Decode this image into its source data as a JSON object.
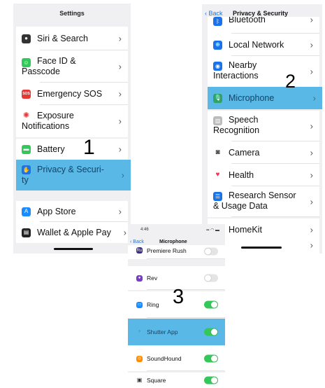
{
  "step_numbers": [
    "1",
    "2",
    "3"
  ],
  "settings": {
    "title": "Settings",
    "items": [
      {
        "label": "Siri & Search",
        "icon": "siri-icon",
        "color": "#333333"
      },
      {
        "label": "Face ID &",
        "label2": "Passcode",
        "icon": "face-id-icon",
        "color": "#34c759"
      },
      {
        "label": "Emergency SOS",
        "icon": "sos-icon",
        "color": "#e53935",
        "badge": "SOS"
      },
      {
        "label": "Exposure",
        "label2": "Notifications",
        "icon": "exposure-icon",
        "color": "#e53935"
      },
      {
        "label": "Battery",
        "icon": "battery-icon",
        "color": "#34c759"
      },
      {
        "label": "Privacy & Securi-",
        "label2": "ty",
        "icon": "hand-icon",
        "color": "#1a73e8"
      },
      {
        "label": "App Store",
        "icon": "app-store-icon",
        "color": "#1a8cff"
      },
      {
        "label": "Wallet & Apple Pay",
        "icon": "wallet-icon",
        "color": "#222222"
      }
    ]
  },
  "privacy": {
    "back": "Back",
    "title": "Privacy & Security",
    "items": [
      {
        "label": "Bluetooth",
        "icon": "bluetooth-icon",
        "color": "#1a73e8"
      },
      {
        "label": "Local Network",
        "icon": "network-icon",
        "color": "#1a73e8"
      },
      {
        "label": "Nearby",
        "label2": "Interactions",
        "icon": "nearby-icon",
        "color": "#1a73e8"
      },
      {
        "label": "Microphone",
        "icon": "microphone-icon",
        "color": "#34c759"
      },
      {
        "label": "Speech",
        "label2": "Recognition",
        "icon": "speech-icon",
        "color": "#999999"
      },
      {
        "label": "Camera",
        "icon": "camera-icon",
        "color": "#555555"
      },
      {
        "label": "Health",
        "icon": "health-icon",
        "color": "#ff2d55"
      },
      {
        "label": "Research Sensor",
        "label2": "& Usage Data",
        "icon": "research-icon",
        "color": "#1a73e8"
      },
      {
        "label": "HomeKit",
        "icon": "homekit-icon",
        "color": "#ff9500"
      }
    ]
  },
  "microphone": {
    "status_time": "4:46",
    "back": "Back",
    "title": "Microphone",
    "apps": [
      {
        "label": "Premiere Rush",
        "icon": "premiere-rush-icon",
        "color": "#3b2a8a",
        "on": false
      },
      {
        "label": "Rev",
        "icon": "rev-icon",
        "color": "#7a3cc8",
        "on": false
      },
      {
        "label": "Ring",
        "icon": "ring-icon",
        "color": "#1a8cff",
        "on": true
      },
      {
        "label": "Shutter App",
        "icon": "shutter-icon",
        "color": "#5ab8e6",
        "on": true
      },
      {
        "label": "SoundHound",
        "icon": "soundhound-icon",
        "color": "#ff8c00",
        "on": true
      },
      {
        "label": "Square",
        "icon": "square-icon",
        "color": "#333333",
        "on": true
      }
    ]
  }
}
